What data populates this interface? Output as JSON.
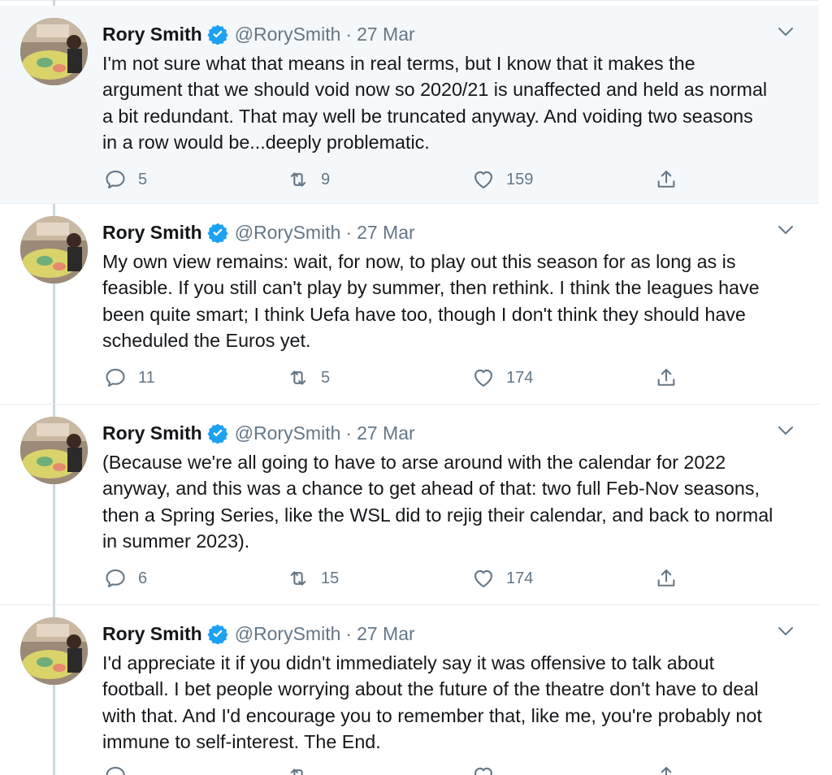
{
  "tweets": [
    {
      "name": "Rory Smith",
      "handle": "@RorySmith",
      "separator": "·",
      "date": "27 Mar",
      "text": "I'm not sure what that means in real terms, but I know that it makes the\nargument that we should void now so 2020/21 is unaffected and held as normal\na bit redundant. That may well be truncated anyway. And voiding two seasons\nin a row would be...deeply problematic.",
      "replies": "5",
      "retweets": "9",
      "likes": "159"
    },
    {
      "name": "Rory Smith",
      "handle": "@RorySmith",
      "separator": "·",
      "date": "27 Mar",
      "text": "My own view remains: wait, for now, to play out this season for as long as is\nfeasible. If you still can't play by summer, then rethink. I think the leagues have\nbeen quite smart; I think Uefa have too, though I don't think they should have\nscheduled the Euros yet.",
      "replies": "11",
      "retweets": "5",
      "likes": "174"
    },
    {
      "name": "Rory Smith",
      "handle": "@RorySmith",
      "separator": "·",
      "date": "27 Mar",
      "text": "(Because we're all going to have to arse around with the calendar for 2022\nanyway, and this was a chance to get ahead of that: two full Feb-Nov seasons,\nthen a Spring Series, like the WSL did to rejig their calendar, and back to normal\nin summer 2023).",
      "replies": "6",
      "retweets": "15",
      "likes": "174"
    },
    {
      "name": "Rory Smith",
      "handle": "@RorySmith",
      "separator": "·",
      "date": "27 Mar",
      "text": "I'd appreciate it if you didn't immediately say it was offensive to talk about\nfootball. I bet people worrying about the future of the theatre don't have to deal\nwith that. And I'd encourage you to remember that, like me, you're probably not\nimmune to self-interest. The End.",
      "replies": "",
      "retweets": "",
      "likes": ""
    }
  ],
  "icons": {
    "verified": "verified-badge-icon",
    "caret": "chevron-down-icon",
    "reply": "reply-icon",
    "retweet": "retweet-icon",
    "like": "heart-icon",
    "share": "share-icon"
  },
  "colors": {
    "highlight_bg": "#f5f8fa",
    "verified": "#1da1f2",
    "secondary_text": "#657786",
    "thread_line": "#ccd6dd"
  }
}
